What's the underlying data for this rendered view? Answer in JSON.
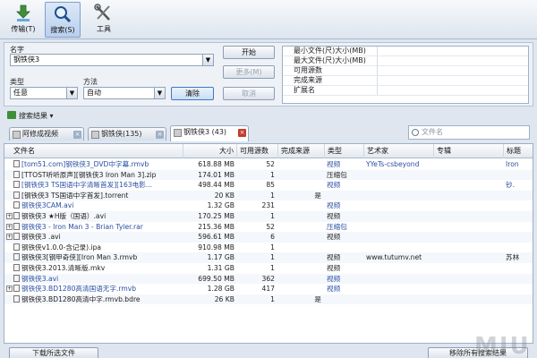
{
  "toolbar": {
    "transfer_label": "传输(T)",
    "search_label": "搜索(S)",
    "tools_label": "工具"
  },
  "search_panel": {
    "name_label": "名字",
    "name_value": "钢铁侠3",
    "type_label": "类型",
    "type_value": "任意",
    "method_label": "方法",
    "method_value": "自动",
    "start_button": "开始",
    "more_button": "更多(M)",
    "cancel_button": "取消",
    "clear_button": "清除",
    "properties": [
      "最小文件(尺)大小(MB)",
      "最大文件(尺)大小(MB)",
      "可用源数",
      "完成来源",
      "扩展名"
    ]
  },
  "results": {
    "title": "搜索结果",
    "tabs": [
      {
        "label": "阿修成视频"
      },
      {
        "label": "钢铁侠(135)"
      },
      {
        "label": "钢铁侠3 (43)"
      }
    ],
    "search_placeholder": "文件名",
    "columns": [
      "文件名",
      "大小",
      "可用源数",
      "完成来源",
      "类型",
      "艺术家",
      "专辑",
      "标题"
    ],
    "rows": [
      {
        "name": "[tom51.com]钢铁侠3_DVD中字幕.rmvb",
        "size": "618.88 MB",
        "src": "52",
        "done": "",
        "type": "视频",
        "artist": "YYeTs-csbeyond",
        "album": "",
        "title": "Iron",
        "blue": true,
        "exp": false
      },
      {
        "name": "[TTOST听听原声][钢铁侠3 Iron Man 3].zip",
        "size": "174.01 MB",
        "src": "1",
        "done": "",
        "type": "压缩包",
        "artist": "",
        "album": "",
        "title": "",
        "blue": false,
        "exp": false
      },
      {
        "name": "[钢铁侠3 TS国语中字清晰首发][163电影...",
        "size": "498.44 MB",
        "src": "85",
        "done": "",
        "type": "视频",
        "artist": "",
        "album": "",
        "title": "钞.",
        "blue": true,
        "exp": false
      },
      {
        "name": "[钢铁侠3 TS国语中字首发].torrent",
        "size": "20 KB",
        "src": "1",
        "done": "是",
        "type": "",
        "artist": "",
        "album": "",
        "title": "",
        "blue": false,
        "exp": false
      },
      {
        "name": "钢铁侠3CAM.avi",
        "size": "1.32 GB",
        "src": "231",
        "done": "",
        "type": "视频",
        "artist": "",
        "album": "",
        "title": "",
        "blue": true,
        "exp": false
      },
      {
        "name": "钢铁侠3 ★H版（国语）.avi",
        "size": "170.25 MB",
        "src": "1",
        "done": "",
        "type": "视频",
        "artist": "",
        "album": "",
        "title": "",
        "blue": false,
        "exp": true
      },
      {
        "name": "钢铁侠3 - Iron Man 3 - Brian Tyler.rar",
        "size": "215.36 MB",
        "src": "52",
        "done": "",
        "type": "压缩包",
        "artist": "",
        "album": "",
        "title": "",
        "blue": true,
        "exp": true
      },
      {
        "name": "钢铁侠3 .avi",
        "size": "596.61 MB",
        "src": "6",
        "done": "",
        "type": "视频",
        "artist": "",
        "album": "",
        "title": "",
        "blue": false,
        "exp": true
      },
      {
        "name": "钢铁侠v1.0.0-含记录).ipa",
        "size": "910.98 MB",
        "src": "1",
        "done": "",
        "type": "",
        "artist": "",
        "album": "",
        "title": "",
        "blue": false,
        "exp": false
      },
      {
        "name": "钢铁侠3[钢甲奇侠][Iron Man 3.rmvb",
        "size": "1.17 GB",
        "src": "1",
        "done": "",
        "type": "视频",
        "artist": "www.tutumv.net",
        "album": "",
        "title": "苏林",
        "blue": false,
        "exp": false
      },
      {
        "name": "钢铁侠3.2013.清晰版.mkv",
        "size": "1.31 GB",
        "src": "1",
        "done": "",
        "type": "视频",
        "artist": "",
        "album": "",
        "title": "",
        "blue": false,
        "exp": false
      },
      {
        "name": "钢铁侠3.avi",
        "size": "699.50 MB",
        "src": "362",
        "done": "",
        "type": "视频",
        "artist": "",
        "album": "",
        "title": "",
        "blue": true,
        "exp": false
      },
      {
        "name": "钢铁侠3.BD1280高清国语无字.rmvb",
        "size": "1.28 GB",
        "src": "417",
        "done": "",
        "type": "视频",
        "artist": "",
        "album": "",
        "title": "",
        "blue": true,
        "exp": true
      },
      {
        "name": "钢铁侠3.BD1280高清中字.rmvb.bdre",
        "size": "26 KB",
        "src": "1",
        "done": "是",
        "type": "",
        "artist": "",
        "album": "",
        "title": "",
        "blue": false,
        "exp": false
      }
    ]
  },
  "footer": {
    "download_button": "下载所选文件",
    "remove_button": "移除所有搜索结果"
  },
  "watermark": "MIU",
  "colors": {
    "accent": "#3e78c2",
    "link_blue": "#2a4fa3",
    "close_red": "#c43b2b"
  }
}
